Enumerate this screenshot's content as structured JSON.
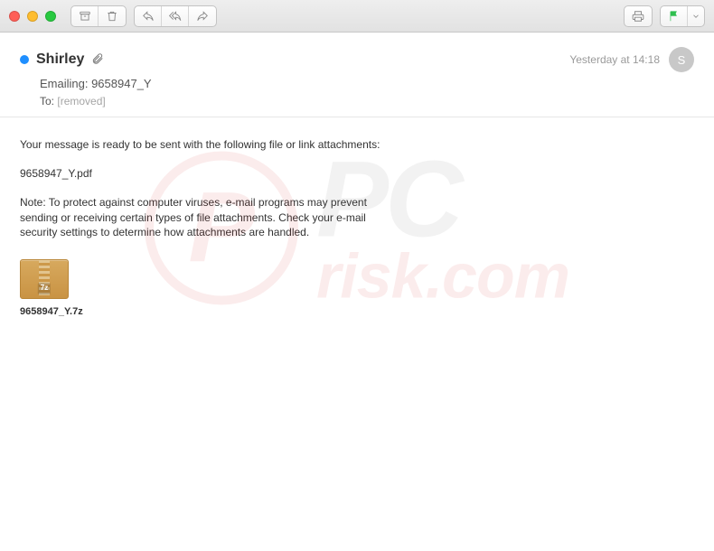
{
  "toolbar": {
    "icons": {
      "archive": "archive-icon",
      "trash": "trash-icon",
      "reply": "reply-icon",
      "reply_all": "reply-all-icon",
      "forward": "forward-icon",
      "print": "print-icon",
      "flag": "flag-icon",
      "dropdown": "chevron-down-icon"
    }
  },
  "message": {
    "sender_name": "Shirley",
    "has_attachment": true,
    "timestamp": "Yesterday at 14:18",
    "avatar_initial": "S",
    "subject": "Emailing: 9658947_Y",
    "to_label": "To:",
    "to_value": "[removed]",
    "body": {
      "para1": "Your message is ready to be sent with the following file or link attachments:",
      "filename_line": "9658947_Y.pdf",
      "note": "Note: To protect against computer viruses, e-mail programs may prevent sending or receiving certain types of file attachments.  Check your e-mail security settings to determine how attachments are handled."
    },
    "attachment": {
      "archive_label": "7z",
      "name": "9658947_Y.7z"
    }
  },
  "watermark": {
    "circle_letter": "P",
    "line1": "PC",
    "line2": "risk.com"
  }
}
